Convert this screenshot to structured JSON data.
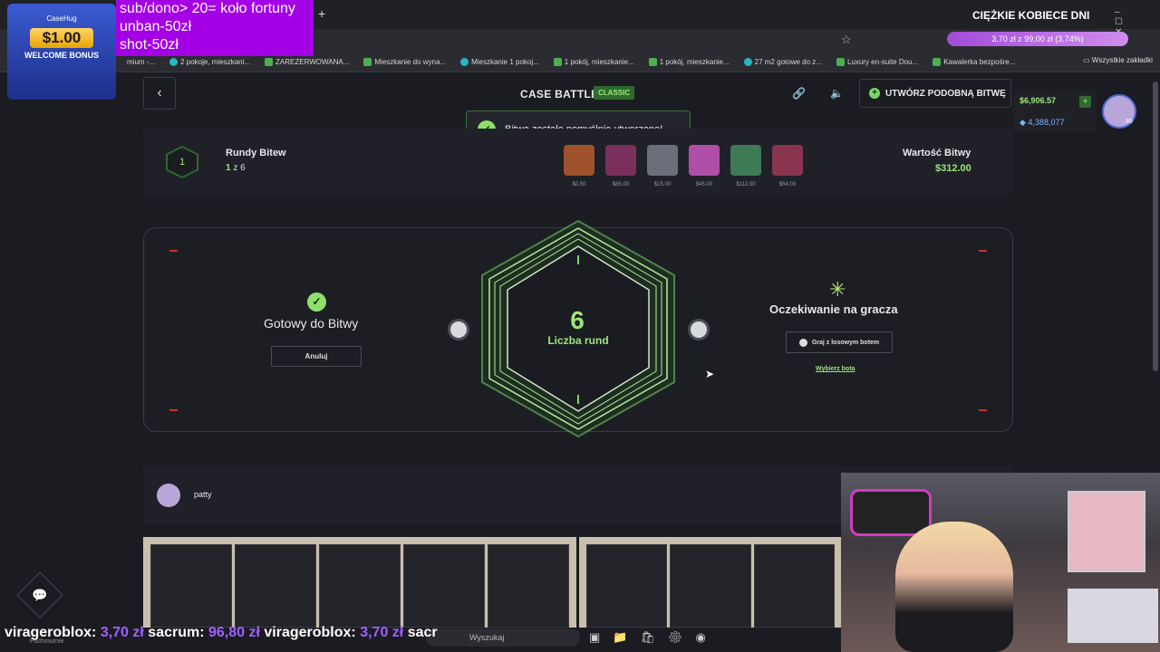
{
  "overlay": {
    "promo_logo": "CaseHug",
    "promo_amount": "$1.00",
    "promo_text": "WELCOME BONUS",
    "commands": [
      "sub/dono> 20= koło fortuny",
      "unban-50zł",
      "shot-50zł"
    ],
    "event_title": "CIĘŻKIE KOBIECE DNI",
    "donation_progress": "3,70 zł z 99,00 zł (3.74%)",
    "ticker": {
      "p1_name": "virageroblox:",
      "p1_amt": "3,70 zł",
      "p2_name": "sacrum:",
      "p2_amt": "96,80 zł",
      "p3_name": "virageroblox:",
      "p3_amt": "3,70 zł",
      "p4_name": "sacr"
    }
  },
  "browser": {
    "bookmarks": [
      "mium -...",
      "2 pokoje, mieszkani...",
      "ZAREZERWOWANA...",
      "Mieszkanie do wyna...",
      "Mieszkanie 1 pokoj...",
      "1 pokój, mieszkanie...",
      "1 pokój, mieszkanie...",
      "27 m2 gotowe do z...",
      "Luxury en-suite Dou...",
      "Kawalerka bezpośre..."
    ],
    "all_bookmarks": "Wszystkie zakładki",
    "window_controls": "– ☐ ✕"
  },
  "header": {
    "title": "CASE BATTLE",
    "mode": "CLASSIC",
    "create_similar": "UTWÓRZ PODOBNĄ BITWĘ",
    "balance_usd": "$6,906.57",
    "balance_coins": "4,388,077",
    "level": "89"
  },
  "toast": {
    "message": "Bitwa została pomyślnie utworzona!"
  },
  "battle_info": {
    "round_number": "1",
    "rounds_label": "Rundy Bitew",
    "rounds_current": "1",
    "rounds_sep": " z 6",
    "value_label": "Wartość Bitwy",
    "value": "$312.00",
    "cases": [
      {
        "price": "$0.50",
        "color": "#a0522d"
      },
      {
        "price": "$85.00",
        "color": "#7a2f5c"
      },
      {
        "price": "$15.00",
        "color": "#6c6f7a"
      },
      {
        "price": "$45.00",
        "color": "#b04fa8"
      },
      {
        "price": "$112.50",
        "color": "#3d7a55"
      },
      {
        "price": "$54.00",
        "color": "#8a3550"
      }
    ]
  },
  "arena": {
    "ready_label": "Gotowy do Bitwy",
    "cancel_label": "Anuluj",
    "rounds_value": "6",
    "rounds_text": "Liczba rund",
    "waiting_label": "Oczekiwanie na gracza",
    "bot_button": "Graj z losowym botem",
    "pick_bot": "Wybierz bota"
  },
  "player": {
    "name": "patty"
  },
  "taskbar": {
    "search_placeholder": "Wyszukaj",
    "weather": "Pochmurnie"
  }
}
